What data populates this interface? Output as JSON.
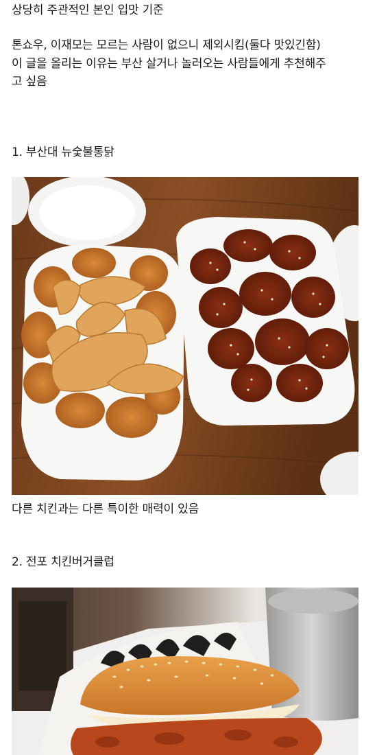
{
  "post": {
    "intro": "상당히 주관적인 본인 입맛 기준",
    "note_lines": [
      "톤쇼우, 이재모는 모르는 사람이 없으니 제외시킴(둘다 맛있긴함)",
      "이 글을 올리는 이유는 부산 살거나 놀러오는 사람들에게 추천해주",
      "고 싶음"
    ],
    "items": [
      {
        "title": "1.  부산대 뉴숯불통닭",
        "caption": "다른 치킨과는 다른 특이한 매력이 있음"
      },
      {
        "title": "2. 전포 치킨버거클럽"
      }
    ]
  }
}
